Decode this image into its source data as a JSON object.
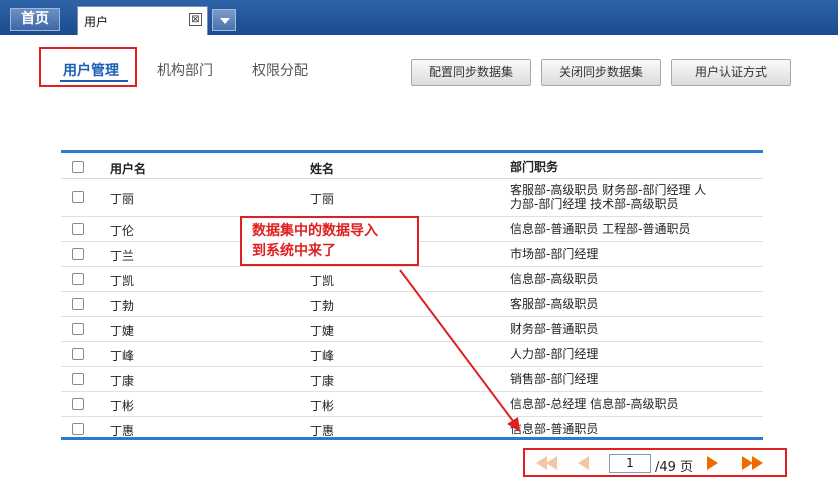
{
  "tabs": {
    "home_label": "首页",
    "active_tab_label": "用户",
    "close_glyph": "⊠"
  },
  "subnav": {
    "items": [
      "用户管理",
      "机构部门",
      "权限分配"
    ]
  },
  "actions": [
    "配置同步数据集",
    "关闭同步数据集",
    "用户认证方式"
  ],
  "table": {
    "columns": [
      "用户名",
      "姓名",
      "部门职务"
    ],
    "rows": [
      {
        "username": "丁丽",
        "name": "丁丽",
        "dept_line1": "客服部-高级职员 财务部-部门经理 人",
        "dept_line2": "力部-部门经理 技术部-高级职员"
      },
      {
        "username": "丁伦",
        "name": "",
        "dept_line1": "信息部-普通职员 工程部-普通职员",
        "dept_line2": ""
      },
      {
        "username": "丁兰",
        "name": "",
        "dept_line1": "市场部-部门经理",
        "dept_line2": ""
      },
      {
        "username": "丁凯",
        "name": "丁凯",
        "dept_line1": "信息部-高级职员",
        "dept_line2": ""
      },
      {
        "username": "丁勃",
        "name": "丁勃",
        "dept_line1": "客服部-高级职员",
        "dept_line2": ""
      },
      {
        "username": "丁婕",
        "name": "丁婕",
        "dept_line1": "财务部-普通职员",
        "dept_line2": ""
      },
      {
        "username": "丁峰",
        "name": "丁峰",
        "dept_line1": "人力部-部门经理",
        "dept_line2": ""
      },
      {
        "username": "丁康",
        "name": "丁康",
        "dept_line1": "销售部-部门经理",
        "dept_line2": ""
      },
      {
        "username": "丁彬",
        "name": "丁彬",
        "dept_line1": "信息部-总经理 信息部-高级职员",
        "dept_line2": ""
      },
      {
        "username": "丁惠",
        "name": "丁惠",
        "dept_line1": "信息部-普通职员",
        "dept_line2": ""
      }
    ]
  },
  "annotation": {
    "line1": "数据集中的数据导入",
    "line2": "到系统中来了",
    "color": "#e02020"
  },
  "pagination": {
    "current_page": "1",
    "total_label": "/49 页"
  },
  "colors": {
    "accent": "#1a5fb4",
    "table_border": "#2a7ad0",
    "highlight": "#e02020",
    "pager_arrow": "#f06a00"
  }
}
